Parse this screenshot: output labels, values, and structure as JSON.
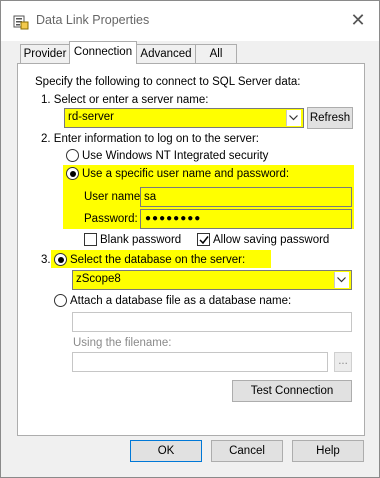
{
  "window": {
    "title": "Data Link Properties"
  },
  "tabs": [
    {
      "label": "Provider"
    },
    {
      "label": "Connection"
    },
    {
      "label": "Advanced"
    },
    {
      "label": "All"
    }
  ],
  "intro": "Specify the following to connect to SQL Server data:",
  "step1": {
    "label": "1. Select or enter a server name:",
    "server_value": "rd-server",
    "refresh_label": "Refresh"
  },
  "step2": {
    "label": "2. Enter information to log on to the server:",
    "nt_security_label": "Use Windows NT Integrated security",
    "specific_user_label": "Use a specific user name and password:",
    "username_label": "User name:",
    "username_value": "sa",
    "password_label": "Password:",
    "password_value": "●●●●●●●●",
    "blank_password_label": "Blank password",
    "allow_saving_label": "Allow saving password"
  },
  "step3": {
    "number": "3.",
    "select_db_label": "Select the database on the server:",
    "database_value": "zScope8",
    "attach_label": "Attach a database file as a database name:",
    "attach_value": "",
    "filename_label": "Using the filename:",
    "filename_value": "",
    "browse_label": "...",
    "test_button_label": "Test Connection"
  },
  "footer": {
    "ok_label": "OK",
    "cancel_label": "Cancel",
    "help_label": "Help"
  },
  "colors": {
    "highlight": "#ffff00",
    "accent": "#0078d7"
  }
}
